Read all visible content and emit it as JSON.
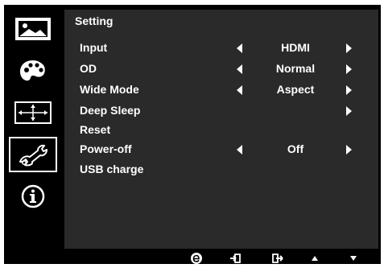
{
  "panel": {
    "title": "Setting"
  },
  "sidebar": {
    "items": [
      {
        "icon": "picture-icon"
      },
      {
        "icon": "color-palette-icon"
      },
      {
        "icon": "image-position-icon"
      },
      {
        "icon": "setting-wrench-icon",
        "selected": true
      },
      {
        "icon": "info-icon"
      }
    ]
  },
  "settings": {
    "input": {
      "label": "Input",
      "value": "HDMI"
    },
    "od": {
      "label": "OD",
      "value": "Normal"
    },
    "wide_mode": {
      "label": "Wide Mode",
      "value": "Aspect"
    },
    "deep_sleep": {
      "label": "Deep Sleep"
    },
    "reset": {
      "label": "Reset"
    },
    "power_off": {
      "label": "Power-off",
      "value": "Off"
    },
    "usb_charge": {
      "label": "USB charge"
    }
  },
  "footer": {
    "buttons": [
      "e-key-icon",
      "enter-icon",
      "exit-icon",
      "up-icon",
      "down-icon"
    ]
  },
  "colors": {
    "osd_background": "#000000",
    "panel_background": "#2a2a2a",
    "text": "#ffffff"
  }
}
